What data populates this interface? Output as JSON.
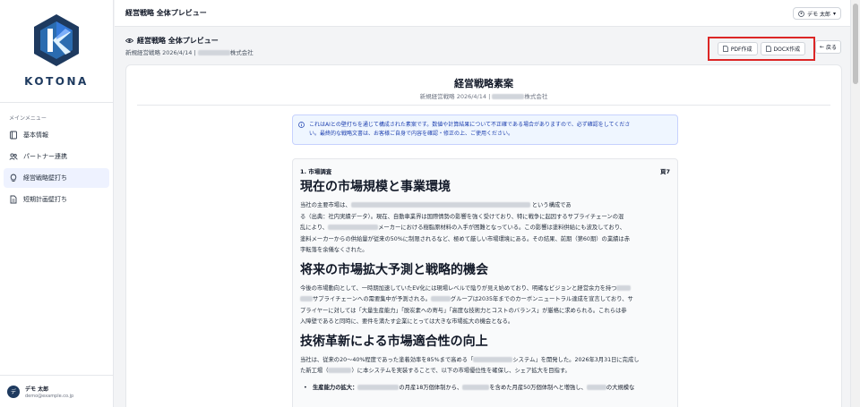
{
  "app": {
    "logo_text": "KOTONA"
  },
  "sidebar": {
    "menu_title": "メインメニュー",
    "items": [
      {
        "label": "基本情報",
        "icon": "book-icon"
      },
      {
        "label": "パートナー連携",
        "icon": "users-icon"
      },
      {
        "label": "経営戦略壁打ち",
        "icon": "lightbulb-icon",
        "active": true
      },
      {
        "label": "短期計画壁打ち",
        "icon": "document-icon"
      }
    ],
    "user": {
      "avatar": "デ",
      "name": "デモ 太郎",
      "email": "demo@example.co.jp"
    }
  },
  "topbar": {
    "title": "経営戦略 全体プレビュー",
    "user_menu": "デモ 太郎"
  },
  "header": {
    "title": "経営戦略 全体プレビュー",
    "subtitle_prefix": "新規経営戦略 2026/4/14 |",
    "subtitle_suffix": "株式会社",
    "pdf_button": "PDF作成",
    "docx_button": "DOCX作成",
    "back_button": "戻る"
  },
  "document": {
    "title": "経営戦略素案",
    "subtitle_prefix": "新規経営戦略 2026/4/14 |",
    "subtitle_suffix": "株式会社",
    "notice_line1": "これはAIとの壁打ちを通じて構成された素案です。数値や計算結果について不正確である場合がありますので、必ず確認をしてくださ",
    "notice_line2": "い。最終的な戦略文書は、お客様ご自身で内容を確認・修正の上、ご使用ください。",
    "section_label": "1. 市場調査",
    "section_page": "頁7",
    "h_market": "現在の市場規模と事業環境",
    "p_market_1a": "当社の主要市場は、",
    "p_market_1b": "という構成であ",
    "p_market_2": "る（出典：社内実績データ）。現在、自動車業界は国際情勢の影響を強く受けており、特に戦争に起因するサプライチェーンの混",
    "p_market_3a": "乱により、",
    "p_market_3b": "メーカーにおける樹脂原材料の入手が困難となっている。この影響は塗料供給にも波及しており、",
    "p_market_4": "塗料メーカーからの供給量が従来の50%に制限されるなど、極めて厳しい市場環境にある。その結果、前期（第60期）の業績は赤",
    "p_market_5": "字転落を余儀なくされた。",
    "h_future": "将来の市場拡大予測と戦略的機会",
    "p_future_1": "今後の市場動向として、一時期加速していたEV化には現場レベルで陰りが見え始めており、明確なビジョンと経営余力を持つ",
    "p_future_2a": "サプライチェーンへの需要集中が予測される。",
    "p_future_2b": "グループは2035年までのカーボンニュートラル達成を宣言しており、サ",
    "p_future_3": "プライヤーに対しては「大量生産能力」「脱炭素への寄与」「高度な技術力とコストのバランス」が厳格に求められる。これらは参",
    "p_future_4": "入障壁であると同時に、要件を満たす企業にとっては大きな市場拡大の機会となる。",
    "h_tech": "技術革新による市場適合性の向上",
    "p_tech_1a": "当社は、従来の20〜40%程度であった塗着効率を85%まで高める「",
    "p_tech_1b": "システム」を開発した。2026年3月31日に完成し",
    "p_tech_2a": "た新工場（",
    "p_tech_2b": "）に本システムを実装することで、以下の市場優位性を確保し、シェア拡大を目指す。",
    "bullet_label": "生産能力の拡大：",
    "bullet_a": "の月産18万個体制から、",
    "bullet_b": "を含めた月産50万個体制へと増強し、",
    "bullet_c": "の大規模な"
  },
  "colors": {
    "brand": "#1e3a5f",
    "highlight": "#dc2626",
    "notice_bg": "#eff6ff"
  }
}
